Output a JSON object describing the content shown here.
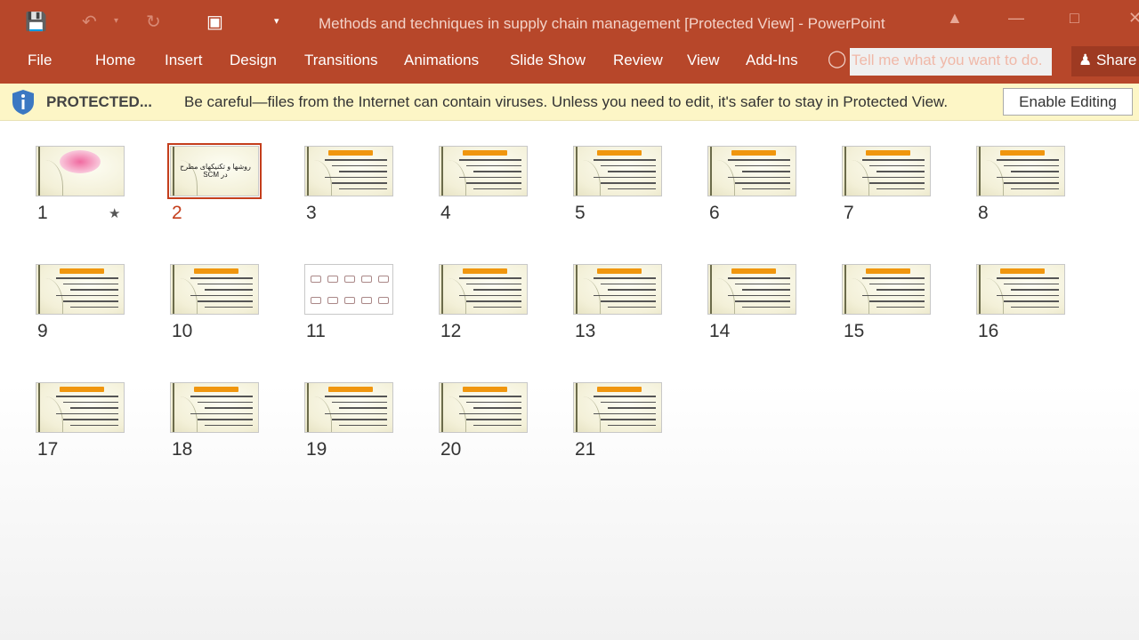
{
  "window": {
    "title": "Methods and techniques in supply chain management [Protected View] - PowerPoint"
  },
  "quick_access": {
    "icons": [
      "save-icon",
      "undo-icon",
      "redo-icon",
      "present-from-start-icon",
      "customize-icon"
    ]
  },
  "ribbon": {
    "tabs": [
      "File",
      "Home",
      "Insert",
      "Design",
      "Transitions",
      "Animations",
      "Slide Show",
      "Review",
      "View",
      "Add-Ins"
    ],
    "tell_me_placeholder": "Tell me what you want to do.",
    "share_label": "Share"
  },
  "protected_bar": {
    "label": "PROTECTED...",
    "message": "Be careful—files from the Internet can contain viruses. Unless you need to edit, it's safer to stay in Protected View.",
    "button": "Enable Editing"
  },
  "slides": [
    {
      "n": "1",
      "title": false,
      "star": true
    },
    {
      "n": "2",
      "selected": true,
      "text": "روشها و تکنیکهای مطرح در SCM"
    },
    {
      "n": "3",
      "title": true
    },
    {
      "n": "4",
      "title": true
    },
    {
      "n": "5",
      "title": true
    },
    {
      "n": "6",
      "title": true
    },
    {
      "n": "7",
      "title": true
    },
    {
      "n": "8",
      "title": true
    },
    {
      "n": "9",
      "title": true
    },
    {
      "n": "10",
      "title": true
    },
    {
      "n": "11",
      "diagram": true
    },
    {
      "n": "12",
      "title": true
    },
    {
      "n": "13",
      "title": true
    },
    {
      "n": "14",
      "title": true
    },
    {
      "n": "15",
      "title": true
    },
    {
      "n": "16",
      "title": true
    },
    {
      "n": "17",
      "title": true
    },
    {
      "n": "18",
      "title": true
    },
    {
      "n": "19",
      "title": true
    },
    {
      "n": "20",
      "title": true
    },
    {
      "n": "21",
      "title": true
    }
  ],
  "colors": {
    "accent": "#b7472a",
    "selected": "#c43e1c",
    "info_bar": "#fdf6c6"
  }
}
